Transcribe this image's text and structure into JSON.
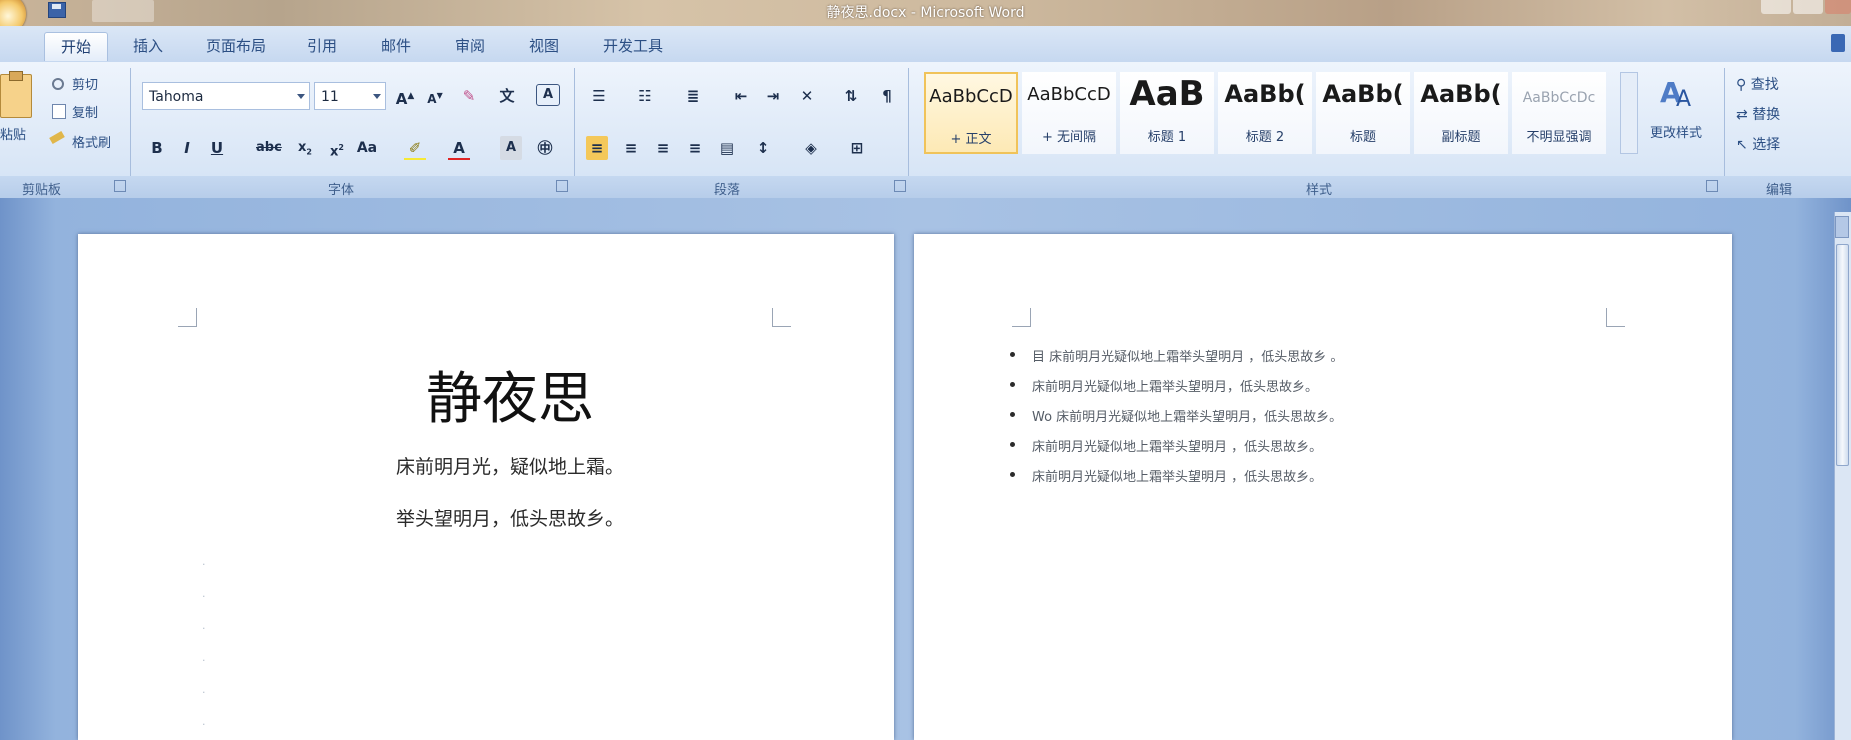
{
  "window": {
    "title": "静夜思.docx - Microsoft Word"
  },
  "tabs": [
    {
      "label": "开始",
      "active": true
    },
    {
      "label": "插入"
    },
    {
      "label": "页面布局"
    },
    {
      "label": "引用"
    },
    {
      "label": "邮件"
    },
    {
      "label": "审阅"
    },
    {
      "label": "视图"
    },
    {
      "label": "开发工具"
    }
  ],
  "clipboard": {
    "paste_label": "粘贴",
    "cut_label": "剪切",
    "copy_label": "复制",
    "format_painter_label": "格式刷",
    "group_label": "剪贴板"
  },
  "font": {
    "name": "Tahoma",
    "size": "11",
    "group_label": "字体"
  },
  "paragraph": {
    "group_label": "段落"
  },
  "styles": {
    "group_label": "样式",
    "items": [
      {
        "sample": "AaBbCcD",
        "name": "+ 正文",
        "selected": true
      },
      {
        "sample": "AaBbCcD",
        "name": "+ 无间隔"
      },
      {
        "sample": "AaB",
        "name": "标题 1"
      },
      {
        "sample": "AaBb(",
        "name": "标题 2"
      },
      {
        "sample": "AaBb(",
        "name": "标题"
      },
      {
        "sample": "AaBb(",
        "name": "副标题"
      },
      {
        "sample": "AaBbCcDc",
        "name": "不明显强调"
      }
    ],
    "change_styles_label": "更改样式"
  },
  "editing": {
    "group_label": "编辑",
    "find_label": "查找",
    "replace_label": "替换",
    "select_label": "选择"
  },
  "document": {
    "title": "静夜思",
    "lines": [
      "床前明月光，疑似地上霜。",
      "举头望明月，低头思故乡。"
    ],
    "bullets": [
      "目 床前明月光疑似地上霜举头望明月 ，低头思故乡 。",
      "床前明月光疑似地上霜举头望明月，低头思故乡。",
      "Wo 床前明月光疑似地上霜举头望明月，低头思故乡。",
      "床前明月光疑似地上霜举头望明月 ，低头思故乡。",
      "床前明月光疑似地上霜举头望明月 ，低头思故乡。"
    ]
  },
  "colors": {
    "accent": "#2c4f84",
    "selected_style": "#f0c35a",
    "ribbon_bg": "#dce8f7",
    "page_bg": "#ffffff"
  }
}
